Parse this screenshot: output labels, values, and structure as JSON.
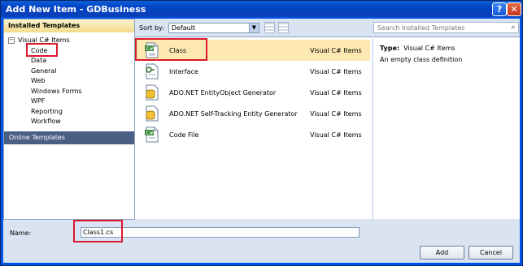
{
  "window": {
    "title": "Add New Item - GDBusiness",
    "help_glyph": "?",
    "close_glyph": "✕"
  },
  "left_pane": {
    "header": "Installed Templates",
    "tree_root": "Visual C# Items",
    "tree_root_expander": "−",
    "items": [
      "Code",
      "Data",
      "General",
      "Web",
      "Windows Forms",
      "WPF",
      "Reporting",
      "Workflow"
    ],
    "online_templates": "Online Templates"
  },
  "sort_bar": {
    "label": "Sort by:",
    "selected": "Default",
    "arrow": "▼"
  },
  "search": {
    "placeholder": "Search Installed Templates",
    "icon": "search-icon"
  },
  "templates": [
    {
      "name": "Class",
      "category": "Visual C# Items",
      "icon": "csharp-class-file-icon",
      "selected": true
    },
    {
      "name": "Interface",
      "category": "Visual C# Items",
      "icon": "interface-icon",
      "selected": false
    },
    {
      "name": "ADO.NET EntityObject Generator",
      "category": "Visual C# Items",
      "icon": "ado-net-generator-icon",
      "selected": false
    },
    {
      "name": "ADO.NET Self-Tracking Entity Generator",
      "category": "Visual C# Items",
      "icon": "ado-net-generator-icon",
      "selected": false
    },
    {
      "name": "Code File",
      "category": "Visual C# Items",
      "icon": "csharp-code-file-icon",
      "selected": false
    }
  ],
  "details": {
    "type_label": "Type:",
    "type_value": "Visual C# Items",
    "description": "An empty class definition"
  },
  "name_field": {
    "label": "Name:",
    "value": "Class1.cs"
  },
  "buttons": {
    "add": "Add",
    "cancel": "Cancel"
  },
  "colors": {
    "titlebar": "#0343c4",
    "selected_row": "#fce8b0",
    "online_templates_bg": "#4b5f85",
    "callout": "#d8192b"
  }
}
